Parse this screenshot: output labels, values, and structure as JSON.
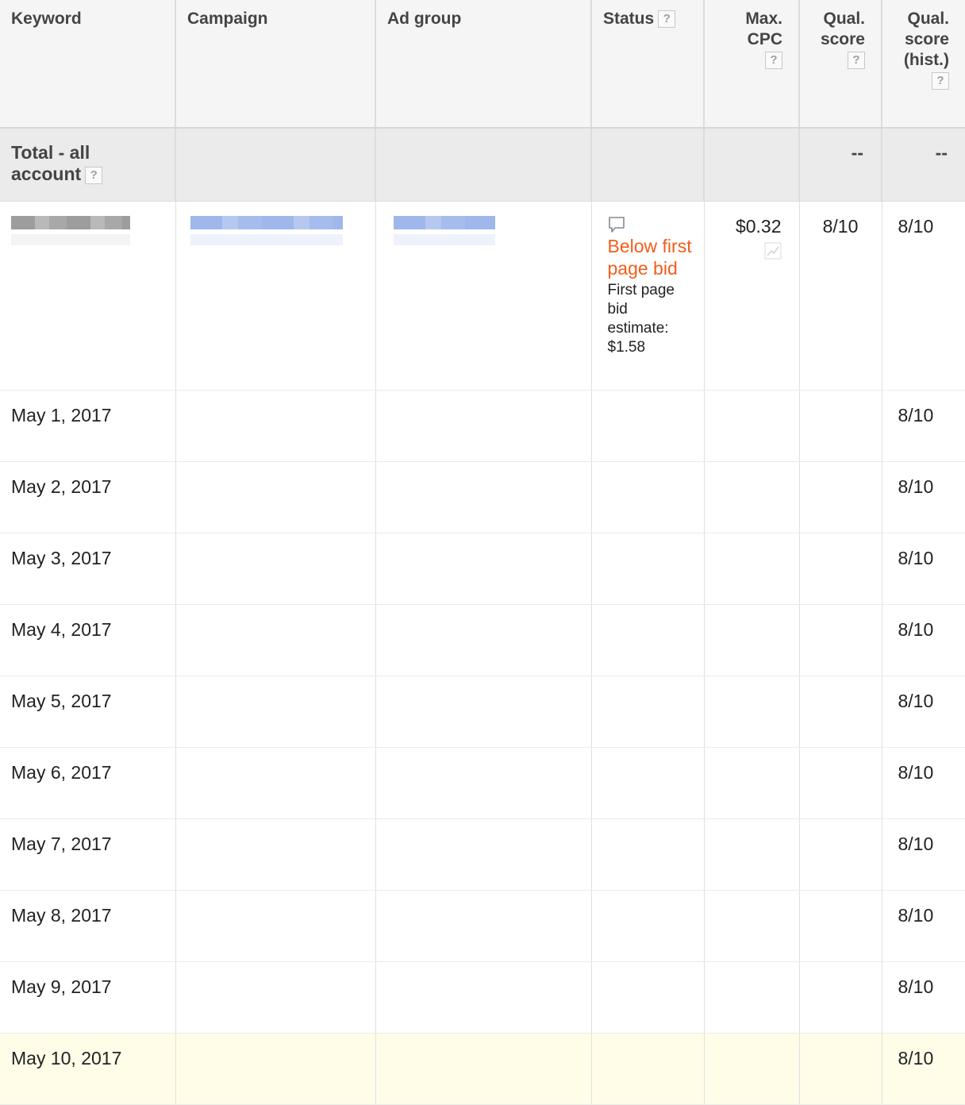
{
  "columns": {
    "keyword": "Keyword",
    "campaign": "Campaign",
    "ad_group": "Ad group",
    "status": "Status",
    "max_cpc_1": "Max.",
    "max_cpc_2": "CPC",
    "qual_1": "Qual.",
    "qual_2": "score",
    "qual_hist_1": "Qual.",
    "qual_hist_2": "score",
    "qual_hist_3": "(hist.)",
    "help_glyph": "?"
  },
  "total_row": {
    "label_1": "Total - all",
    "label_2": "account",
    "qual_score": "--",
    "qual_score_hist": "--"
  },
  "keyword_row": {
    "status_warning": "Below first page bid",
    "status_detail": "First page bid estimate: $1.58",
    "max_cpc": "$0.32",
    "qual_score": "8/10",
    "qual_score_hist": "8/10",
    "status_icon": "comment-bubble-icon",
    "cpc_icon": "trend-chart-icon"
  },
  "daily_rows": [
    {
      "date": "May 1, 2017",
      "qual_score_hist": "8/10"
    },
    {
      "date": "May 2, 2017",
      "qual_score_hist": "8/10"
    },
    {
      "date": "May 3, 2017",
      "qual_score_hist": "8/10"
    },
    {
      "date": "May 4, 2017",
      "qual_score_hist": "8/10"
    },
    {
      "date": "May 5, 2017",
      "qual_score_hist": "8/10"
    },
    {
      "date": "May 6, 2017",
      "qual_score_hist": "8/10"
    },
    {
      "date": "May 7, 2017",
      "qual_score_hist": "8/10"
    },
    {
      "date": "May 8, 2017",
      "qual_score_hist": "8/10"
    },
    {
      "date": "May 9, 2017",
      "qual_score_hist": "8/10"
    },
    {
      "date": "May 10, 2017",
      "qual_score_hist": "8/10",
      "highlighted": true
    }
  ],
  "colors": {
    "warning": "#f25d1b",
    "header_bg": "#f5f5f5",
    "total_bg": "#ebebeb",
    "highlight_row_bg": "#fffde8"
  }
}
